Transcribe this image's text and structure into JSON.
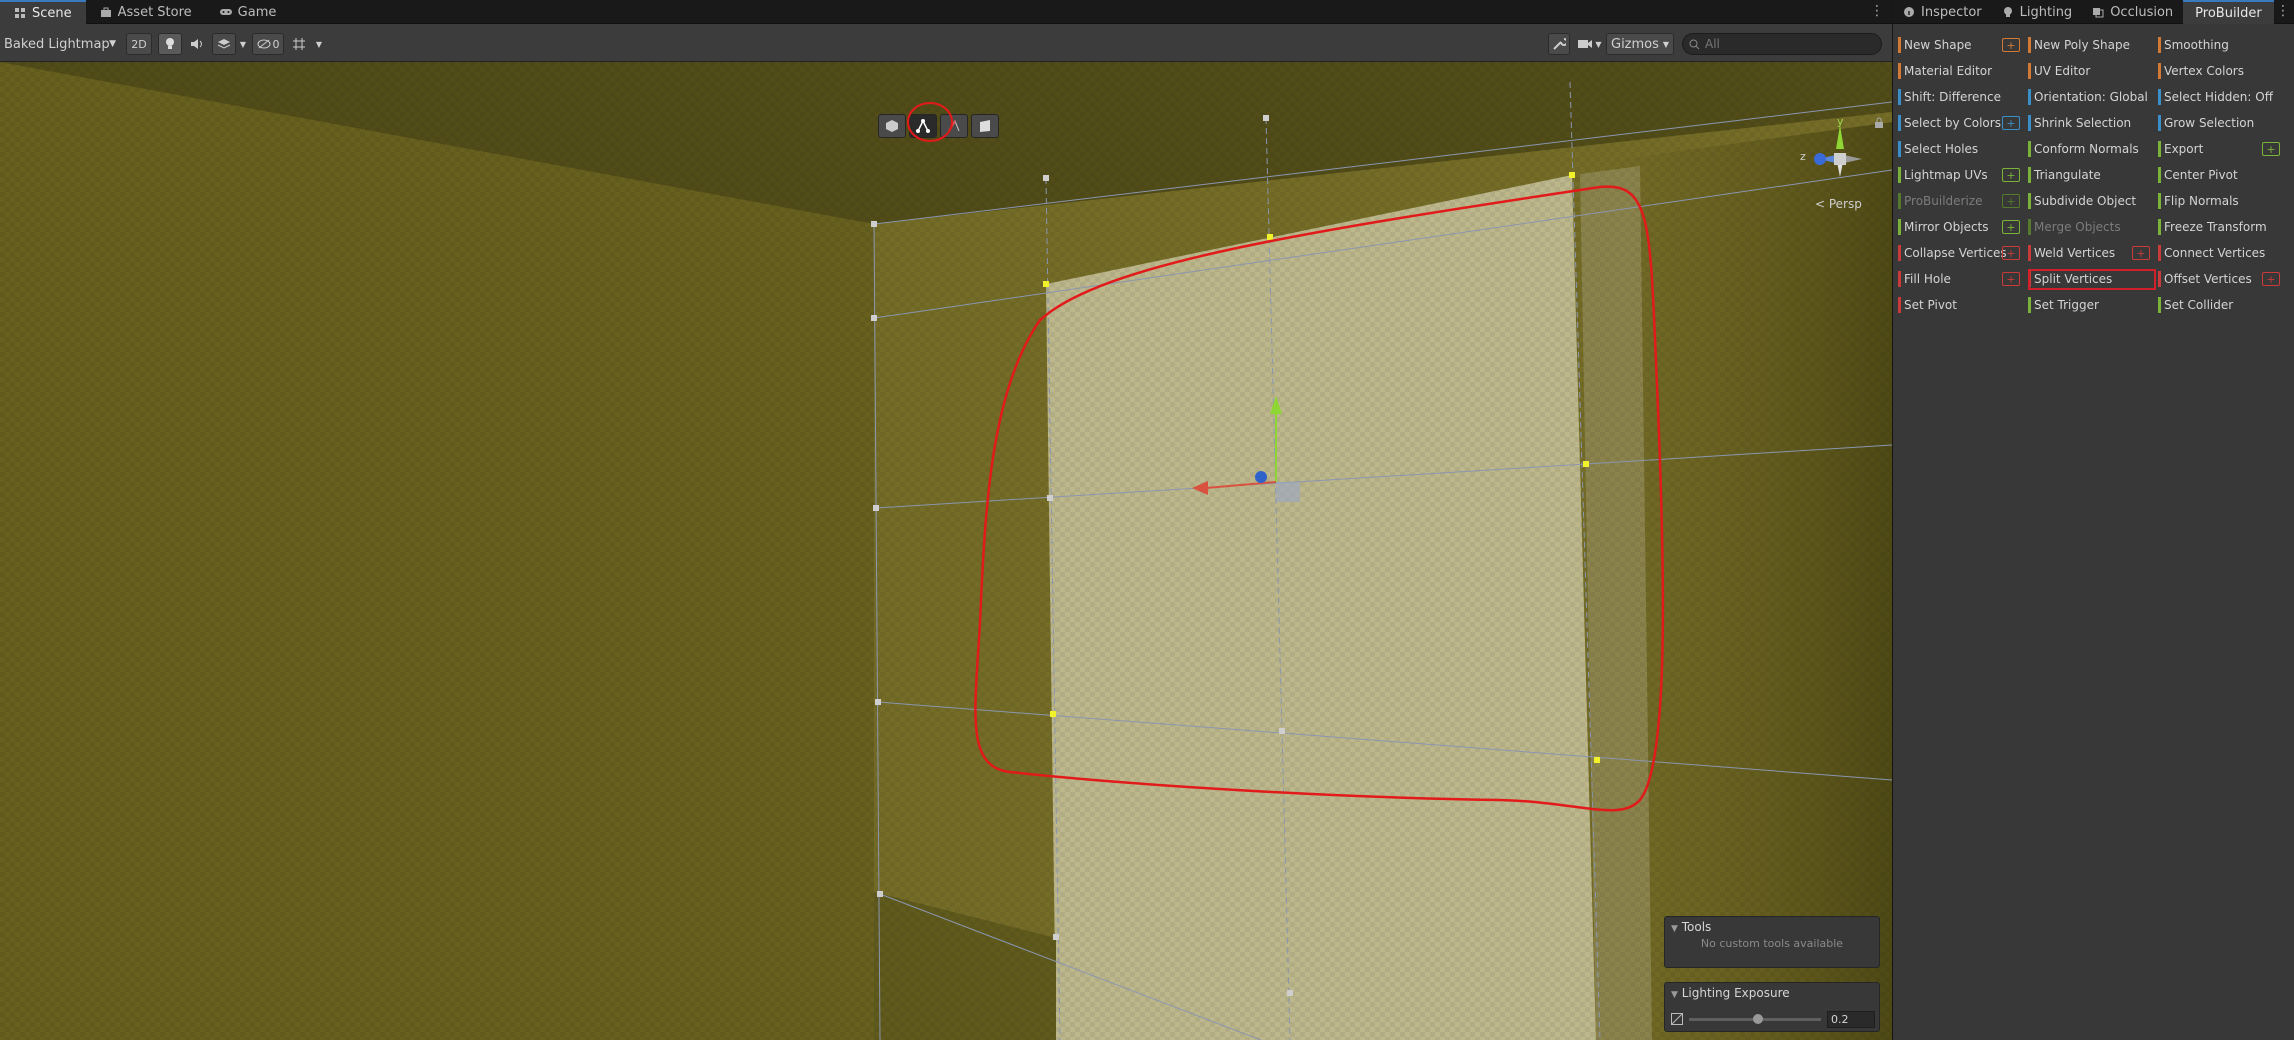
{
  "scene_tabs": [
    {
      "label": "Scene",
      "icon": "grid-icon",
      "active": true
    },
    {
      "label": "Asset Store",
      "icon": "bag-icon",
      "active": false
    },
    {
      "label": "Game",
      "icon": "gamepad-icon",
      "active": false
    }
  ],
  "toolbar": {
    "draw_mode": "Baked Lightmap",
    "mode_2d": "2D",
    "hidden_count": "0",
    "gizmos": "Gizmos",
    "search_placeholder": "All"
  },
  "viewport": {
    "persp_label": "< Persp",
    "axis_labels": {
      "y": "y",
      "z": "z"
    }
  },
  "tools_overlay": {
    "title": "Tools",
    "message": "No custom tools available"
  },
  "lighting_overlay": {
    "title": "Lighting Exposure",
    "value": "0.2",
    "slider_fraction": 0.52
  },
  "right_tabs": [
    {
      "label": "Inspector",
      "icon": "info-icon",
      "active": false
    },
    {
      "label": "Lighting",
      "icon": "bulb-icon",
      "active": false
    },
    {
      "label": "Occlusion",
      "icon": "occlusion-icon",
      "active": false
    },
    {
      "label": "ProBuilder",
      "icon": "",
      "active": true
    }
  ],
  "probuilder": {
    "colors": {
      "orange": "#d27a35",
      "blue": "#3b8fc8",
      "green": "#7bb239",
      "red": "#c93a3a",
      "dim_green": "#557a2c"
    },
    "items": [
      {
        "label": "New Shape",
        "color": "orange",
        "plus": true,
        "plus_color": "orange"
      },
      {
        "label": "New Poly Shape",
        "color": "orange"
      },
      {
        "label": "Smoothing",
        "color": "orange"
      },
      {
        "label": "Material Editor",
        "color": "orange"
      },
      {
        "label": "UV Editor",
        "color": "orange"
      },
      {
        "label": "Vertex Colors",
        "color": "orange"
      },
      {
        "label": "Shift: Difference",
        "color": "blue"
      },
      {
        "label": "Orientation: Global",
        "color": "blue"
      },
      {
        "label": "Select Hidden: Off",
        "color": "blue"
      },
      {
        "label": "Select by Colors",
        "color": "blue",
        "plus": true,
        "plus_color": "blue"
      },
      {
        "label": "Shrink Selection",
        "color": "blue"
      },
      {
        "label": "Grow Selection",
        "color": "blue"
      },
      {
        "label": "Select Holes",
        "color": "blue"
      },
      {
        "label": "Conform Normals",
        "color": "green"
      },
      {
        "label": "Export",
        "color": "green",
        "plus": true,
        "plus_color": "green"
      },
      {
        "label": "Lightmap UVs",
        "color": "green",
        "plus": true,
        "plus_color": "green"
      },
      {
        "label": "Triangulate",
        "color": "green"
      },
      {
        "label": "Center Pivot",
        "color": "green"
      },
      {
        "label": "ProBuilderize",
        "color": "dim_green",
        "disabled": true,
        "plus": true,
        "plus_color": "dim_green"
      },
      {
        "label": "Subdivide Object",
        "color": "green"
      },
      {
        "label": "Flip Normals",
        "color": "green"
      },
      {
        "label": "Mirror Objects",
        "color": "green",
        "plus": true,
        "plus_color": "green"
      },
      {
        "label": "Merge Objects",
        "color": "dim_green",
        "disabled": true
      },
      {
        "label": "Freeze Transform",
        "color": "green"
      },
      {
        "label": "Collapse Vertices",
        "color": "red",
        "plus": true,
        "plus_color": "red"
      },
      {
        "label": "Weld Vertices",
        "color": "red",
        "plus": true,
        "plus_color": "red"
      },
      {
        "label": "Connect Vertices",
        "color": "red"
      },
      {
        "label": "Fill Hole",
        "color": "red",
        "plus": true,
        "plus_color": "red"
      },
      {
        "label": "Split Vertices",
        "color": "red",
        "highlighted": true
      },
      {
        "label": "Offset Vertices",
        "color": "red",
        "plus": true,
        "plus_color": "red"
      },
      {
        "label": "Set Pivot",
        "color": "red"
      },
      {
        "label": "Set Trigger",
        "color": "green"
      },
      {
        "label": "Set Collider",
        "color": "green"
      }
    ]
  }
}
